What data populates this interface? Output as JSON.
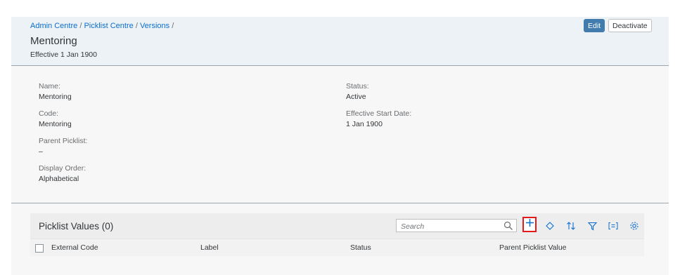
{
  "header": {
    "breadcrumb": [
      "Admin Centre",
      "Picklist Centre",
      "Versions"
    ],
    "separator": "/",
    "title": "Mentoring",
    "subtitle": "Effective 1 Jan 1900",
    "edit_label": "Edit",
    "deactivate_label": "Deactivate"
  },
  "details": {
    "name_label": "Name:",
    "name_value": "Mentoring",
    "code_label": "Code:",
    "code_value": "Mentoring",
    "parent_label": "Parent Picklist:",
    "parent_value": "–",
    "order_label": "Display Order:",
    "order_value": "Alphabetical",
    "status_label": "Status:",
    "status_value": "Active",
    "start_label": "Effective Start Date:",
    "start_value": "1 Jan 1900"
  },
  "table": {
    "title": "Picklist Values (0)",
    "search_placeholder": "Search",
    "columns": [
      "External Code",
      "Label",
      "Status",
      "Parent Picklist Value"
    ]
  },
  "icons": {
    "search": "search-icon",
    "add": "plus-icon",
    "diamond": "diamond-icon",
    "sort": "sort-icon",
    "filter": "filter-icon",
    "columns": "list-icon",
    "settings": "gear-icon"
  },
  "colors": {
    "accent": "#427cac",
    "link": "#0a6ed1",
    "highlight": "#e51a1a"
  }
}
